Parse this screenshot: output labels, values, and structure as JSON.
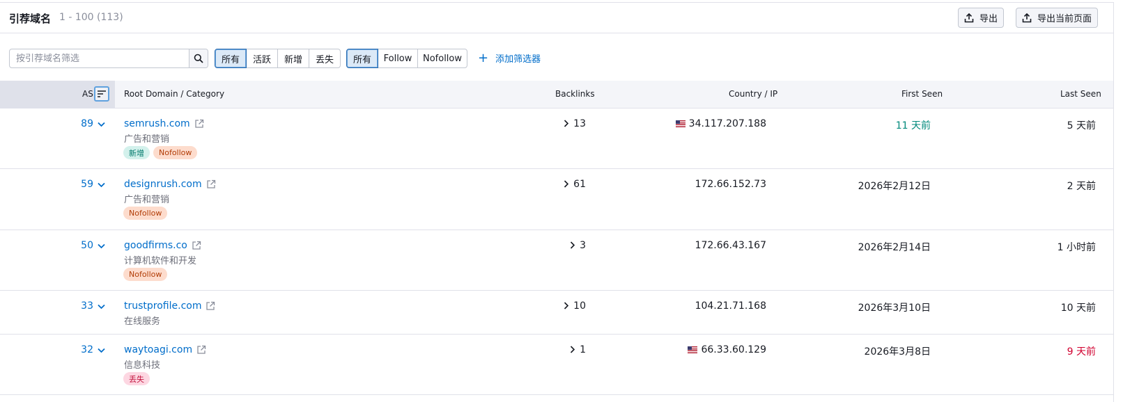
{
  "header": {
    "title": "引荐域名",
    "count": "1 - 100 (113)",
    "export_label": "导出",
    "export_page_label": "导出当前页面"
  },
  "filters": {
    "search_placeholder": "按引荐域名筛选",
    "status_segments": [
      "所有",
      "活跃",
      "新增",
      "丢失"
    ],
    "status_active": "所有",
    "follow_segments": [
      "所有",
      "Follow",
      "Nofollow"
    ],
    "follow_active": "所有",
    "add_filter_label": "添加筛选器"
  },
  "table": {
    "columns": {
      "as": "AS",
      "domain": "Root Domain / Category",
      "backlinks": "Backlinks",
      "country_ip": "Country / IP",
      "first_seen": "First Seen",
      "last_seen": "Last Seen"
    },
    "rows": [
      {
        "as": "89",
        "domain": "semrush.com",
        "category": "广告和营销",
        "tags": [
          "新增",
          "Nofollow"
        ],
        "backlinks": "13",
        "flag": "us",
        "ip": "34.117.207.188",
        "first_seen": "11 天前",
        "last_seen": "5 天前"
      },
      {
        "as": "59",
        "domain": "designrush.com",
        "category": "广告和营销",
        "tags": [
          "Nofollow"
        ],
        "backlinks": "61",
        "flag": "",
        "ip": "172.66.152.73",
        "first_seen": "2026年2月12日",
        "last_seen": "2 天前"
      },
      {
        "as": "50",
        "domain": "goodfirms.co",
        "category": "计算机软件和开发",
        "tags": [
          "Nofollow"
        ],
        "backlinks": "3",
        "flag": "",
        "ip": "172.66.43.167",
        "first_seen": "2026年2月14日",
        "last_seen": "1 小时前"
      },
      {
        "as": "33",
        "domain": "trustprofile.com",
        "category": "在线服务",
        "tags": [],
        "backlinks": "10",
        "flag": "",
        "ip": "104.21.71.168",
        "first_seen": "2026年3月10日",
        "last_seen": "10 天前"
      },
      {
        "as": "32",
        "domain": "waytoagi.com",
        "category": "信息科技",
        "tags": [
          "丢失"
        ],
        "backlinks": "1",
        "flag": "us",
        "ip": "66.33.60.129",
        "first_seen": "2026年3月8日",
        "last_seen": "9 天前"
      }
    ]
  },
  "colors": {
    "link": "#006dca",
    "new_green": "#00897b",
    "lost_red": "#d1002f"
  },
  "icons": [
    "export-icon",
    "search-icon",
    "sort-icon",
    "chevron-down-icon",
    "chevron-right-icon",
    "external-link-icon",
    "us-flag-icon"
  ]
}
